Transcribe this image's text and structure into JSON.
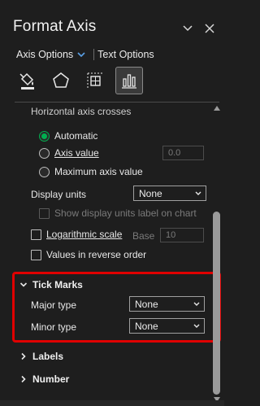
{
  "header": {
    "title": "Format Axis",
    "tabs": [
      {
        "label": "Axis Options",
        "active": true
      },
      {
        "label": "Text Options",
        "active": false
      }
    ],
    "icons": [
      "fill-line-icon",
      "effects-icon",
      "size-properties-icon",
      "axis-options-icon"
    ]
  },
  "axis_options": {
    "horizontal_axis_crosses_label": "Horizontal axis crosses",
    "radio_automatic": "Automatic",
    "radio_axis_value": "Axis value",
    "axis_value_input": "0.0",
    "radio_maximum": "Maximum axis value",
    "display_units_label": "Display units",
    "display_units_value": "None",
    "show_units_label": "Show display units label on chart",
    "log_scale_label": "Logarithmic scale",
    "base_label": "Base",
    "base_value": "10",
    "reverse_order_label": "Values in reverse order"
  },
  "tick_marks": {
    "title": "Tick Marks",
    "major_label": "Major type",
    "major_value": "None",
    "minor_label": "Minor type",
    "minor_value": "None"
  },
  "sections": {
    "labels": "Labels",
    "number": "Number"
  },
  "colors": {
    "accent": "#00b050",
    "highlight": "#e00000",
    "background": "#1e1e1e"
  }
}
